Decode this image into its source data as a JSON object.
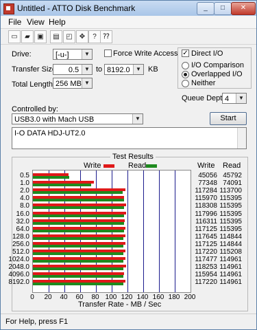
{
  "window": {
    "title": "Untitled - ATTO Disk Benchmark"
  },
  "caption_buttons": {
    "minimize": "_",
    "maximize": "□",
    "close": "✕"
  },
  "menu": [
    "File",
    "View",
    "Help"
  ],
  "toolbar_icons": [
    "new-file-icon",
    "open-folder-icon",
    "save-icon",
    "print-icon",
    "print-preview-icon",
    "move-icon",
    "help-icon",
    "context-help-icon"
  ],
  "settings": {
    "drive_label": "Drive:",
    "drive_value": "[-u-]",
    "force_write_label": "Force Write Access",
    "force_write_checked": false,
    "direct_io_label": "Direct I/O",
    "direct_io_checked": true,
    "transfer_size_label": "Transfer Size:",
    "transfer_from": "0.5",
    "to_label": "to",
    "transfer_to": "8192.0",
    "kb_label": "KB",
    "total_length_label": "Total Length:",
    "total_length_value": "256 MB",
    "io_comparison_label": "I/O Comparison",
    "overlapped_io_label": "Overlapped I/O",
    "neither_label": "Neither",
    "selected_io_mode": "Overlapped I/O",
    "queue_depth_label": "Queue Depth:",
    "queue_depth_value": "4",
    "controlled_by_label": "Controlled by:",
    "controlled_by_value": "USB3.0 with Mach USB",
    "start_label": "Start",
    "description": "I-O DATA HDJ-UT2.0"
  },
  "results": {
    "group_title": "Test Results",
    "legend_write": "Write",
    "legend_read": "Read",
    "col_write": "Write",
    "col_read": "Read",
    "xlabel": "Transfer Rate - MB / Sec",
    "write_color": "#e01919",
    "read_color": "#1e8a1e"
  },
  "chart_data": {
    "type": "bar",
    "orientation": "horizontal",
    "categories": [
      "0.5",
      "1.0",
      "2.0",
      "4.0",
      "8.0",
      "16.0",
      "32.0",
      "64.0",
      "128.0",
      "256.0",
      "512.0",
      "1024.0",
      "2048.0",
      "4096.0",
      "8192.0"
    ],
    "series": [
      {
        "name": "Write",
        "values": [
          45056,
          77348,
          117284,
          115970,
          118308,
          117996,
          116311,
          117125,
          117645,
          117125,
          117220,
          117477,
          118253,
          115954,
          117220
        ]
      },
      {
        "name": "Read",
        "values": [
          45792,
          74091,
          113700,
          115395,
          115395,
          115395,
          115395,
          115395,
          114844,
          114844,
          115208,
          114961,
          114961,
          114961,
          114961
        ]
      }
    ],
    "xlabel": "Transfer Rate - MB / Sec",
    "xticks": [
      "0",
      "20",
      "40",
      "60",
      "80",
      "100",
      "120",
      "140",
      "160",
      "180",
      "200"
    ],
    "xlim": [
      0,
      200
    ],
    "grid": true,
    "legend": "top"
  },
  "statusbar": {
    "text": "For Help, press F1"
  }
}
